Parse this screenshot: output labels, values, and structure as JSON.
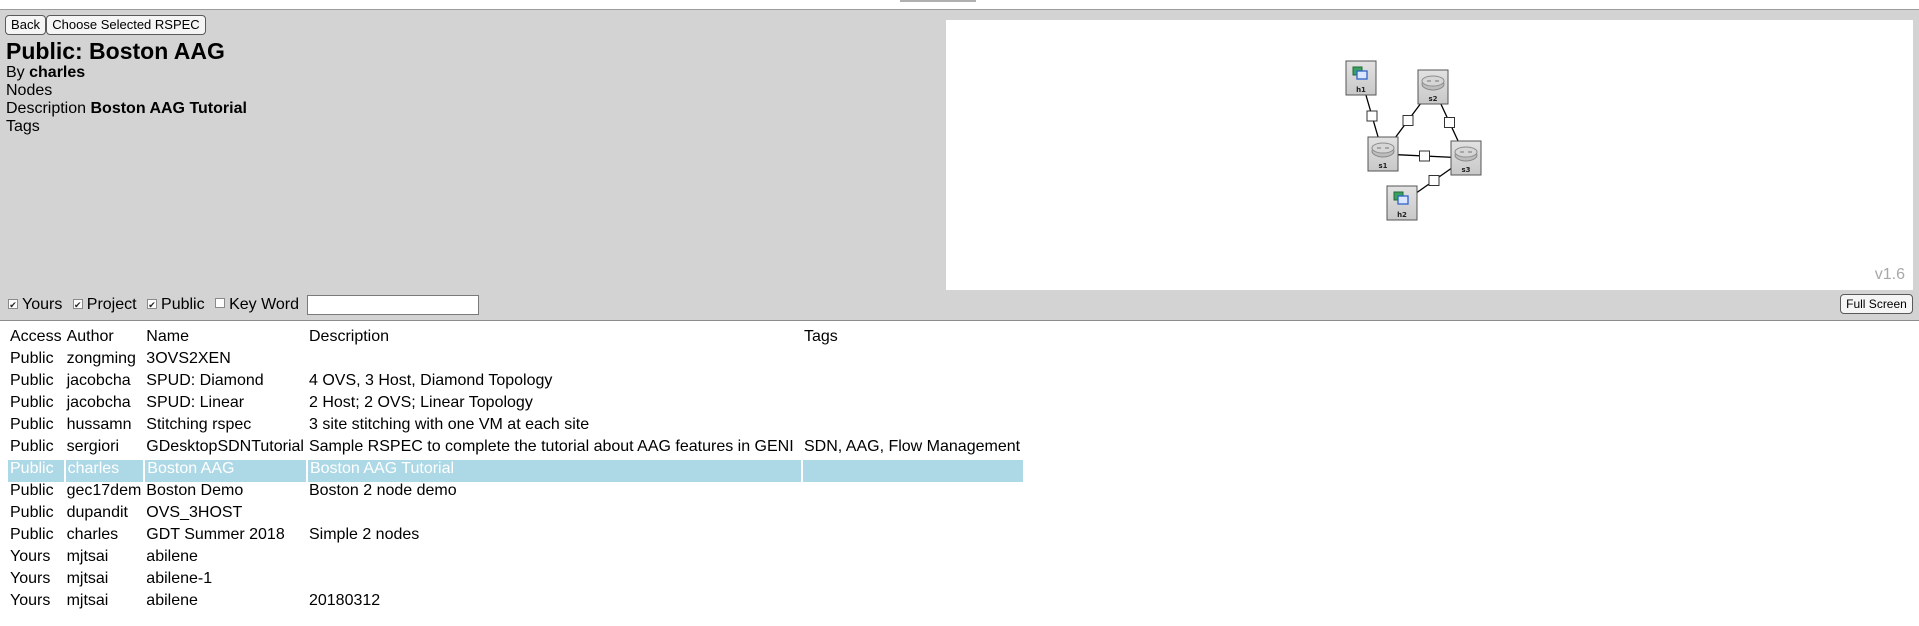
{
  "header": {
    "back_label": "Back",
    "choose_label": "Choose Selected RSPEC",
    "title": "Public: Boston AAG",
    "by_label": "By",
    "author": "charles",
    "nodes_label": "Nodes",
    "description_label": "Description",
    "description": "Boston AAG Tutorial",
    "tags_label": "Tags"
  },
  "topology": {
    "version": "v1.6",
    "nodes": [
      {
        "id": "h1",
        "label": "h1",
        "kind": "host-icon"
      },
      {
        "id": "s2",
        "label": "s2",
        "kind": "switch-icon"
      },
      {
        "id": "s1",
        "label": "s1",
        "kind": "switch-icon"
      },
      {
        "id": "s3",
        "label": "s3",
        "kind": "switch-icon"
      },
      {
        "id": "h2",
        "label": "h2",
        "kind": "host-icon"
      }
    ],
    "links": [
      [
        "h1",
        "s1"
      ],
      [
        "s1",
        "s2"
      ],
      [
        "s2",
        "s3"
      ],
      [
        "s1",
        "s3"
      ],
      [
        "s3",
        "h2"
      ]
    ]
  },
  "filters": {
    "yours": {
      "label": "Yours",
      "checked": true
    },
    "project": {
      "label": "Project",
      "checked": true
    },
    "public": {
      "label": "Public",
      "checked": true
    },
    "keyword": {
      "label": "Key Word",
      "checked": false,
      "value": ""
    },
    "fullscreen_label": "Full Screen"
  },
  "table": {
    "headers": {
      "access": "Access",
      "author": "Author",
      "name": "Name",
      "description": "Description",
      "tags": "Tags"
    },
    "selected_index": 5,
    "rows": [
      {
        "access": "Public",
        "author": "zongming",
        "name": "3OVS2XEN",
        "description": "",
        "tags": ""
      },
      {
        "access": "Public",
        "author": "jacobcha",
        "name": "SPUD: Diamond",
        "description": "4 OVS, 3 Host, Diamond Topology",
        "tags": ""
      },
      {
        "access": "Public",
        "author": "jacobcha",
        "name": "SPUD: Linear",
        "description": "2 Host; 2 OVS; Linear Topology",
        "tags": ""
      },
      {
        "access": "Public",
        "author": "hussamn",
        "name": "Stitching rspec",
        "description": "3 site stitching with one VM at each site",
        "tags": ""
      },
      {
        "access": "Public",
        "author": "sergiori",
        "name": "GDesktopSDNTutorial",
        "description": "Sample RSPEC to complete the tutorial about AAG features in GENI",
        "tags": "SDN, AAG, Flow Management"
      },
      {
        "access": "Public",
        "author": "charles",
        "name": "Boston AAG",
        "description": "Boston AAG Tutorial",
        "tags": ""
      },
      {
        "access": "Public",
        "author": "gec17dem",
        "name": "Boston Demo",
        "description": "Boston 2 node demo",
        "tags": ""
      },
      {
        "access": "Public",
        "author": "dupandit",
        "name": "OVS_3HOST",
        "description": "",
        "tags": ""
      },
      {
        "access": "Public",
        "author": "charles",
        "name": "GDT Summer 2018",
        "description": "Simple 2 nodes",
        "tags": ""
      },
      {
        "access": "Yours",
        "author": "mjtsai",
        "name": "abilene",
        "description": "",
        "tags": ""
      },
      {
        "access": "Yours",
        "author": "mjtsai",
        "name": "abilene-1",
        "description": "",
        "tags": ""
      },
      {
        "access": "Yours",
        "author": "mjtsai",
        "name": "abilene",
        "description": "20180312",
        "tags": ""
      }
    ]
  }
}
